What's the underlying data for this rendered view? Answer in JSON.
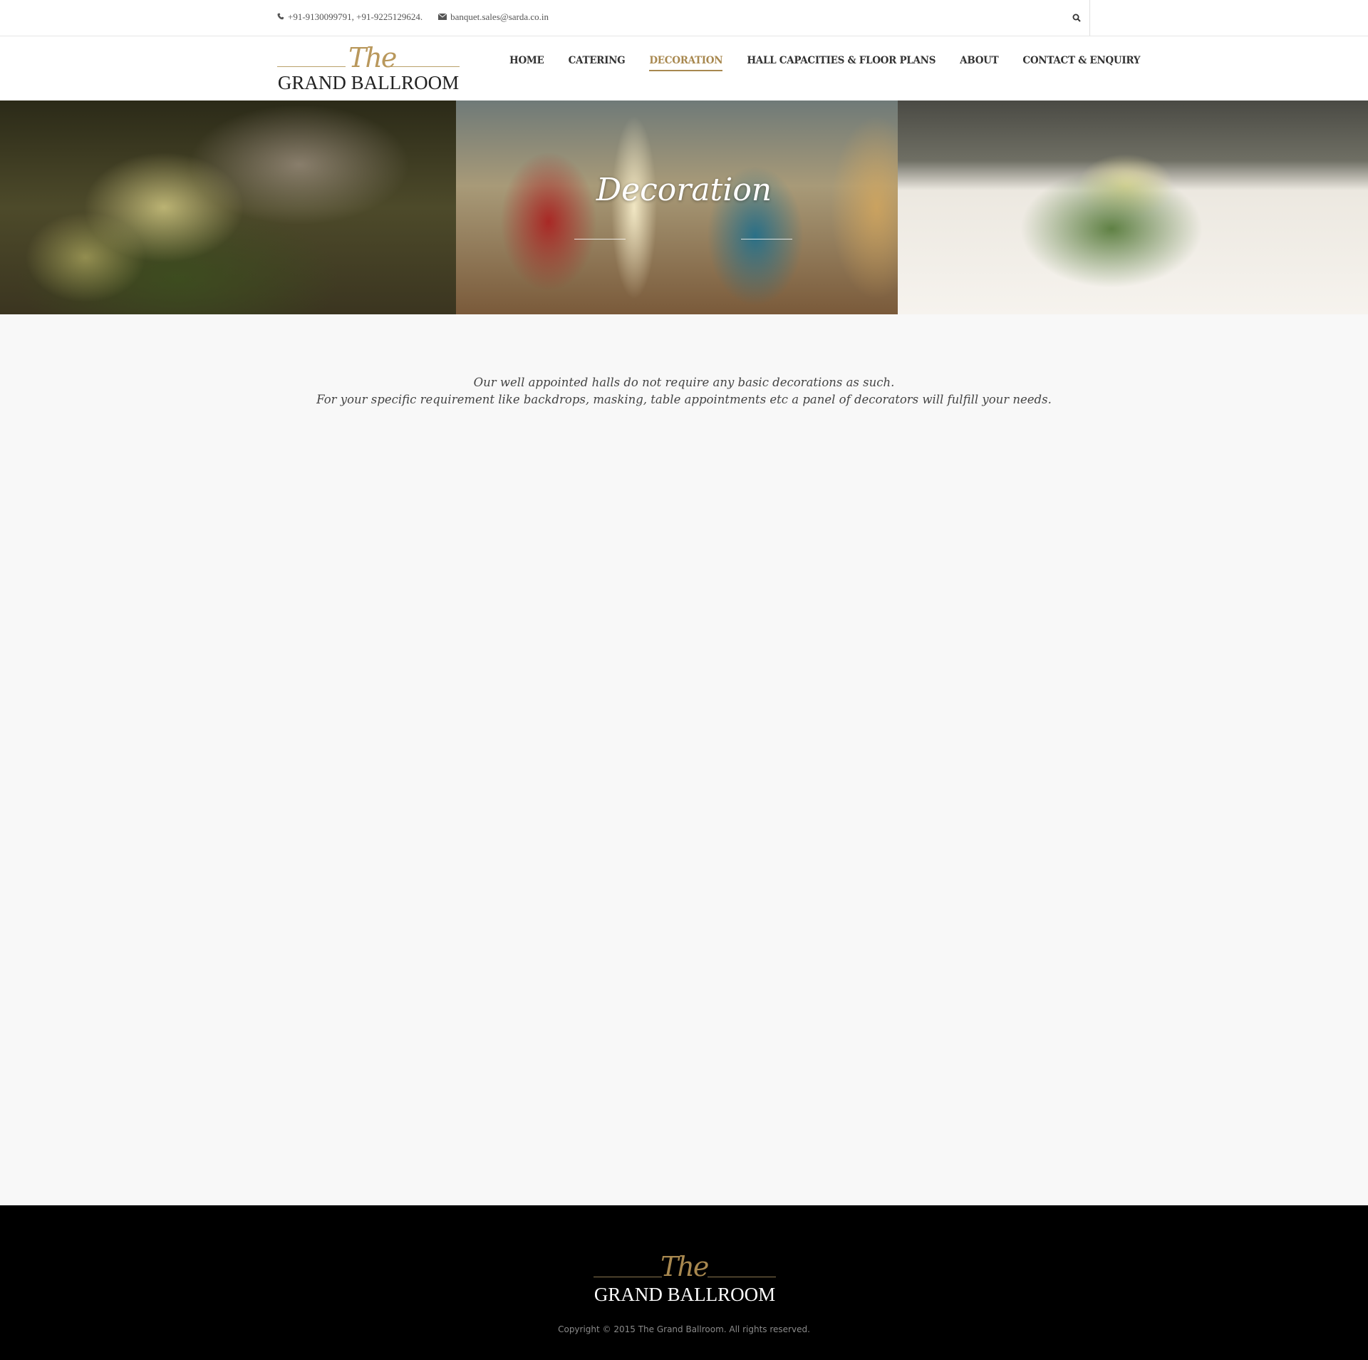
{
  "topbar": {
    "phone": "+91-9130099791, +91-9225129624.",
    "email": "banquet.sales@sarda.co.in"
  },
  "logo": {
    "script": "The",
    "name": "GRAND BALLROOM"
  },
  "nav": {
    "items": [
      {
        "label": "HOME"
      },
      {
        "label": "CATERING"
      },
      {
        "label": "DECORATION"
      },
      {
        "label": "HALL CAPACITIES & FLOOR PLANS"
      },
      {
        "label": "ABOUT"
      },
      {
        "label": "CONTACT & ENQUIRY"
      }
    ],
    "active": "DECORATION"
  },
  "hero": {
    "title": "Decoration"
  },
  "content": {
    "line1": "Our well appointed halls do not require any basic decorations as such.",
    "line2": "For your specific requirement like backdrops, masking, table appointments etc a panel of decorators will fulfill your needs."
  },
  "footer": {
    "script": "The",
    "name": "GRAND BALLROOM",
    "copyright": "Copyright © 2015 The Grand Ballroom. All rights reserved."
  },
  "colors": {
    "accent": "#a8884f",
    "footer_bg": "#000000",
    "page_bg": "#f8f8f8"
  }
}
